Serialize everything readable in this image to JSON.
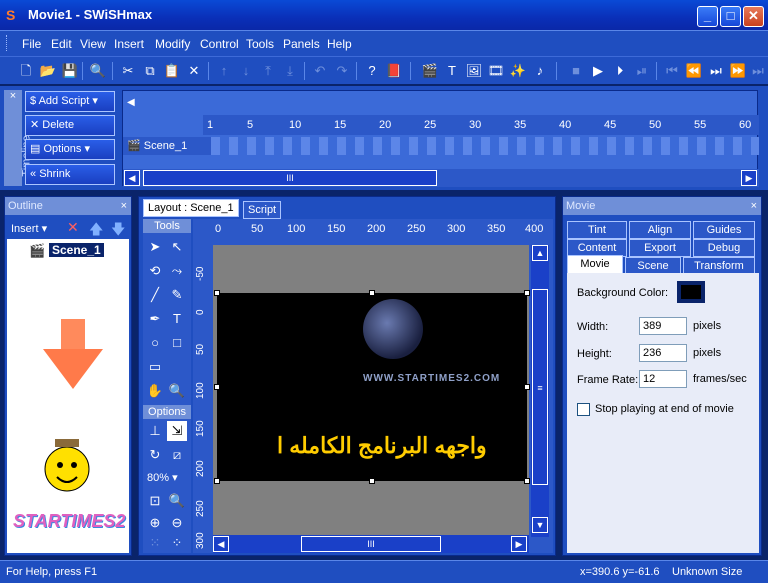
{
  "window": {
    "title": "Movie1 - SWiSHmax"
  },
  "menu": [
    "File",
    "Edit",
    "View",
    "Insert",
    "Modify",
    "Control",
    "Tools",
    "Panels",
    "Help"
  ],
  "timeline": {
    "side_label": "Timeline",
    "buttons": [
      "Add Script",
      "Delete",
      "Options",
      "Shrink"
    ],
    "ruler": [
      "1",
      "5",
      "10",
      "15",
      "20",
      "25",
      "30",
      "35",
      "40",
      "45",
      "50",
      "55",
      "60"
    ],
    "scene_name": "Scene_1",
    "scroll_thumb": "III"
  },
  "outline": {
    "title": "Outline",
    "insert_label": "Insert",
    "scene_node": "Scene_1",
    "brand": "STARTIMES2"
  },
  "layout": {
    "tabs": [
      "Layout : Scene_1",
      "Script"
    ],
    "tools_header": "Tools",
    "options_header": "Options",
    "zoom": "80%",
    "hruler": [
      "0",
      "50",
      "100",
      "150",
      "200",
      "250",
      "300",
      "350",
      "400"
    ],
    "vruler": [
      "-50",
      "0",
      "50",
      "100",
      "150",
      "200",
      "250",
      "300"
    ],
    "watermark": "WWW.STARTIMES2.COM",
    "arabic_text": "واجهه البرنامج الكامله ا",
    "scroll_thumb": "III"
  },
  "movie_panel": {
    "title": "Movie",
    "tabs_row1": [
      "Tint",
      "Align",
      "Guides"
    ],
    "tabs_row2": [
      "Content",
      "Export",
      "Debug"
    ],
    "tabs_row3": [
      "Movie",
      "Scene",
      "Transform"
    ],
    "bg_label": "Background Color:",
    "width_label": "Width:",
    "width_value": "389",
    "height_label": "Height:",
    "height_value": "236",
    "framerate_label": "Frame Rate:",
    "framerate_value": "12",
    "pixels": "pixels",
    "fps": "frames/sec",
    "stop_label": "Stop playing at end of movie"
  },
  "status": {
    "help": "For Help, press F1",
    "coords": "x=390.6 y=-61.6",
    "size": "Unknown Size"
  },
  "colors": {
    "accent": "#1f4ec0",
    "selection": "#0a246a",
    "text_yellow": "#ffcc00"
  }
}
